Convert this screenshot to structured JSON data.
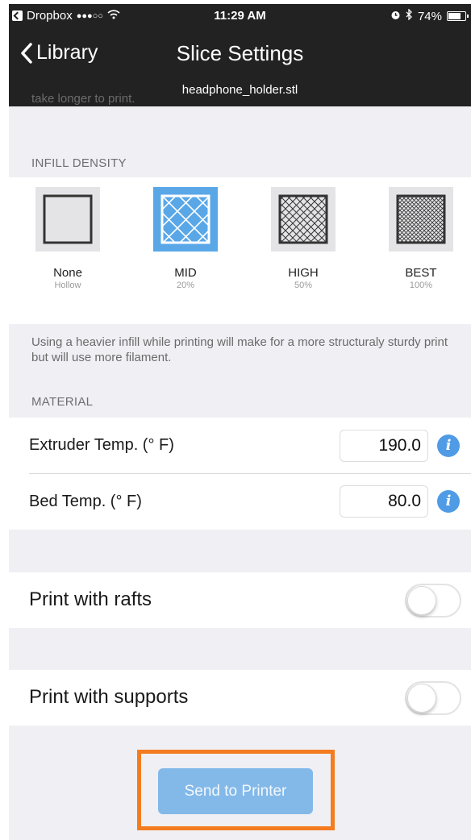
{
  "status_bar": {
    "carrier": "Dropbox",
    "signal": "●●●○○",
    "time": "11:29 AM",
    "battery": "74%"
  },
  "nav": {
    "back_label": "Library",
    "title": "Slice Settings",
    "subtitle": "headphone_holder.stl"
  },
  "quality_note_tail": "take longer to print.",
  "infill": {
    "header": "INFILL DENSITY",
    "options": [
      {
        "name": "None",
        "sub": "Hollow"
      },
      {
        "name": "MID",
        "sub": "20%"
      },
      {
        "name": "HIGH",
        "sub": "50%"
      },
      {
        "name": "BEST",
        "sub": "100%"
      }
    ],
    "selected": "MID",
    "note": "Using a heavier infill while printing will make for a more structuraly sturdy print but will use more filament."
  },
  "material": {
    "header": "MATERIAL",
    "extruder_label": "Extruder Temp. (° F)",
    "extruder_value": "190.0",
    "bed_label": "Bed Temp. (° F)",
    "bed_value": "80.0"
  },
  "options": {
    "rafts_label": "Print with rafts",
    "rafts_on": false,
    "supports_label": "Print with supports",
    "supports_on": false
  },
  "send_button": "Send to Printer",
  "colors": {
    "accent": "#5aa7e8",
    "button": "#83b9e9",
    "highlight": "#f47c20",
    "nav_bg": "#222222"
  }
}
